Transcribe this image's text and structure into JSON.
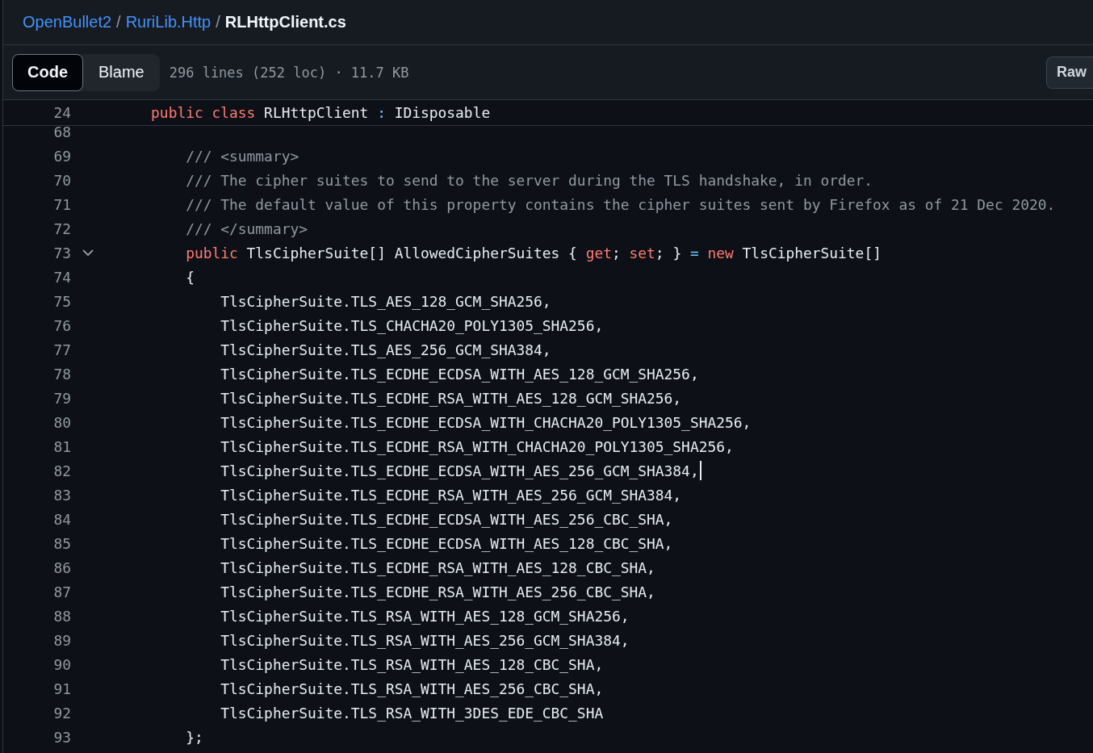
{
  "breadcrumb": [
    {
      "label": "OpenBullet2",
      "kind": "link"
    },
    {
      "label": "RuriLib.Http",
      "kind": "link"
    },
    {
      "label": "RLHttpClient.cs",
      "kind": "current"
    }
  ],
  "separator": "/",
  "tabs": [
    {
      "label": "Code",
      "selected": true
    },
    {
      "label": "Blame",
      "selected": false
    }
  ],
  "file_info": "296 lines (252 loc) · 11.7 KB",
  "raw_button": "Raw",
  "sticky_line": {
    "number": "24",
    "tokens": [
      {
        "kind": "keyword",
        "text": "    public class"
      },
      {
        "kind": "plain",
        "text": " RLHttpClient "
      },
      {
        "kind": "operator",
        "text": ":"
      },
      {
        "kind": "plain",
        "text": " IDisposable"
      }
    ]
  },
  "lines": [
    {
      "number": "68",
      "partial": true,
      "cursor": false
    },
    {
      "number": "69",
      "partial": false,
      "cursor": false,
      "tokens": [
        {
          "kind": "comment",
          "text": "        /// <summary>"
        }
      ]
    },
    {
      "number": "70",
      "partial": false,
      "cursor": false,
      "tokens": [
        {
          "kind": "comment",
          "text": "        /// The cipher suites to send to the server during the TLS handshake, in order."
        }
      ]
    },
    {
      "number": "71",
      "partial": false,
      "cursor": false,
      "tokens": [
        {
          "kind": "comment",
          "text": "        /// The default value of this property contains the cipher suites sent by Firefox as of 21 Dec 2020."
        }
      ]
    },
    {
      "number": "72",
      "partial": false,
      "cursor": false,
      "tokens": [
        {
          "kind": "comment",
          "text": "        /// </summary>"
        }
      ]
    },
    {
      "number": "73",
      "partial": false,
      "cursor": false,
      "fold": {
        "expanded": true
      },
      "tokens": [
        {
          "kind": "keyword",
          "text": "        public"
        },
        {
          "kind": "plain",
          "text": " TlsCipherSuite[] AllowedCipherSuites { "
        },
        {
          "kind": "keyword",
          "text": "get"
        },
        {
          "kind": "plain",
          "text": "; "
        },
        {
          "kind": "keyword",
          "text": "set"
        },
        {
          "kind": "plain",
          "text": "; } "
        },
        {
          "kind": "operator",
          "text": "="
        },
        {
          "kind": "keyword",
          "text": " new"
        },
        {
          "kind": "plain",
          "text": " TlsCipherSuite[]"
        }
      ]
    },
    {
      "number": "74",
      "partial": false,
      "cursor": false,
      "tokens": [
        {
          "kind": "plain",
          "text": "        {"
        }
      ]
    },
    {
      "number": "75",
      "partial": false,
      "cursor": false,
      "tokens": [
        {
          "kind": "plain",
          "text": "            TlsCipherSuite.TLS_AES_128_GCM_SHA256,"
        }
      ]
    },
    {
      "number": "76",
      "partial": false,
      "cursor": false,
      "tokens": [
        {
          "kind": "plain",
          "text": "            TlsCipherSuite.TLS_CHACHA20_POLY1305_SHA256,"
        }
      ]
    },
    {
      "number": "77",
      "partial": false,
      "cursor": false,
      "tokens": [
        {
          "kind": "plain",
          "text": "            TlsCipherSuite.TLS_AES_256_GCM_SHA384,"
        }
      ]
    },
    {
      "number": "78",
      "partial": false,
      "cursor": false,
      "tokens": [
        {
          "kind": "plain",
          "text": "            TlsCipherSuite.TLS_ECDHE_ECDSA_WITH_AES_128_GCM_SHA256,"
        }
      ]
    },
    {
      "number": "79",
      "partial": false,
      "cursor": false,
      "tokens": [
        {
          "kind": "plain",
          "text": "            TlsCipherSuite.TLS_ECDHE_RSA_WITH_AES_128_GCM_SHA256,"
        }
      ]
    },
    {
      "number": "80",
      "partial": false,
      "cursor": false,
      "tokens": [
        {
          "kind": "plain",
          "text": "            TlsCipherSuite.TLS_ECDHE_ECDSA_WITH_CHACHA20_POLY1305_SHA256,"
        }
      ]
    },
    {
      "number": "81",
      "partial": false,
      "cursor": false,
      "tokens": [
        {
          "kind": "plain",
          "text": "            TlsCipherSuite.TLS_ECDHE_RSA_WITH_CHACHA20_POLY1305_SHA256,"
        }
      ]
    },
    {
      "number": "82",
      "partial": false,
      "cursor": true,
      "tokens": [
        {
          "kind": "plain",
          "text": "            TlsCipherSuite.TLS_ECDHE_ECDSA_WITH_AES_256_GCM_SHA384,"
        }
      ]
    },
    {
      "number": "83",
      "partial": false,
      "cursor": false,
      "tokens": [
        {
          "kind": "plain",
          "text": "            TlsCipherSuite.TLS_ECDHE_RSA_WITH_AES_256_GCM_SHA384,"
        }
      ]
    },
    {
      "number": "84",
      "partial": false,
      "cursor": false,
      "tokens": [
        {
          "kind": "plain",
          "text": "            TlsCipherSuite.TLS_ECDHE_ECDSA_WITH_AES_256_CBC_SHA,"
        }
      ]
    },
    {
      "number": "85",
      "partial": false,
      "cursor": false,
      "tokens": [
        {
          "kind": "plain",
          "text": "            TlsCipherSuite.TLS_ECDHE_ECDSA_WITH_AES_128_CBC_SHA,"
        }
      ]
    },
    {
      "number": "86",
      "partial": false,
      "cursor": false,
      "tokens": [
        {
          "kind": "plain",
          "text": "            TlsCipherSuite.TLS_ECDHE_RSA_WITH_AES_128_CBC_SHA,"
        }
      ]
    },
    {
      "number": "87",
      "partial": false,
      "cursor": false,
      "tokens": [
        {
          "kind": "plain",
          "text": "            TlsCipherSuite.TLS_ECDHE_RSA_WITH_AES_256_CBC_SHA,"
        }
      ]
    },
    {
      "number": "88",
      "partial": false,
      "cursor": false,
      "tokens": [
        {
          "kind": "plain",
          "text": "            TlsCipherSuite.TLS_RSA_WITH_AES_128_GCM_SHA256,"
        }
      ]
    },
    {
      "number": "89",
      "partial": false,
      "cursor": false,
      "tokens": [
        {
          "kind": "plain",
          "text": "            TlsCipherSuite.TLS_RSA_WITH_AES_256_GCM_SHA384,"
        }
      ]
    },
    {
      "number": "90",
      "partial": false,
      "cursor": false,
      "tokens": [
        {
          "kind": "plain",
          "text": "            TlsCipherSuite.TLS_RSA_WITH_AES_128_CBC_SHA,"
        }
      ]
    },
    {
      "number": "91",
      "partial": false,
      "cursor": false,
      "tokens": [
        {
          "kind": "plain",
          "text": "            TlsCipherSuite.TLS_RSA_WITH_AES_256_CBC_SHA,"
        }
      ]
    },
    {
      "number": "92",
      "partial": false,
      "cursor": false,
      "tokens": [
        {
          "kind": "plain",
          "text": "            TlsCipherSuite.TLS_RSA_WITH_3DES_EDE_CBC_SHA"
        }
      ]
    },
    {
      "number": "93",
      "partial": false,
      "cursor": false,
      "tokens": [
        {
          "kind": "plain",
          "text": "        };"
        }
      ]
    }
  ]
}
